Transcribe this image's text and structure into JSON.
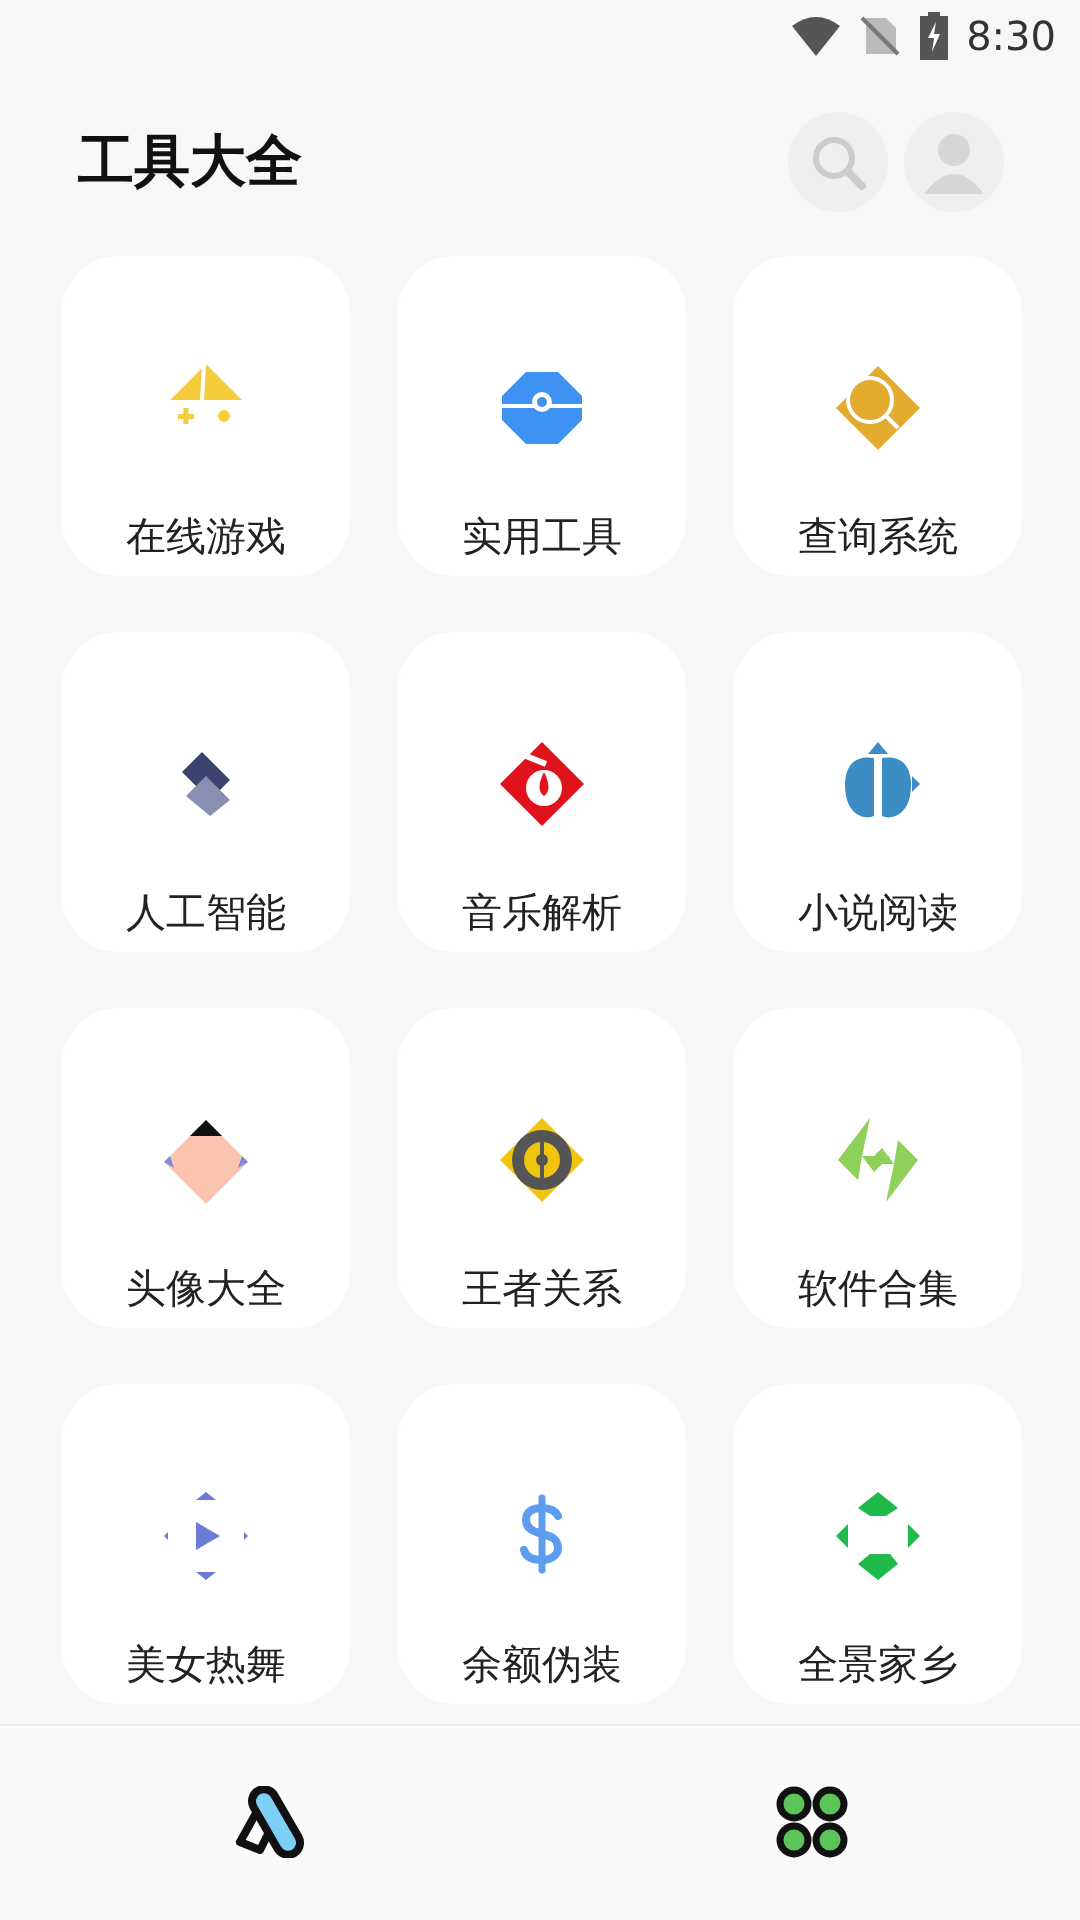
{
  "status_bar": {
    "time": "8:30"
  },
  "header": {
    "title": "工具大全"
  },
  "tools": [
    {
      "label": "在线游戏"
    },
    {
      "label": "实用工具"
    },
    {
      "label": "查询系统"
    },
    {
      "label": "人工智能"
    },
    {
      "label": "音乐解析"
    },
    {
      "label": "小说阅读"
    },
    {
      "label": "头像大全"
    },
    {
      "label": "王者关系"
    },
    {
      "label": "软件合集"
    },
    {
      "label": "美女热舞"
    },
    {
      "label": "余额伪装"
    },
    {
      "label": "全景家乡"
    }
  ]
}
